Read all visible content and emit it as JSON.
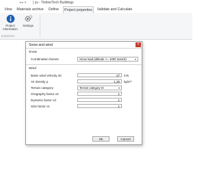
{
  "app": {
    "title": "| ys - TimberTech Buildings",
    "qat_glyphs": "◂ ▸ ▾"
  },
  "tabs": [
    {
      "label": "View"
    },
    {
      "label": "Materials archive"
    },
    {
      "label": "Define"
    },
    {
      "label": "Project properties",
      "active": true
    },
    {
      "label": "Validate and Calculate"
    }
  ],
  "ribbon": {
    "project_info_label": "Project\nInformation",
    "settings_label": "Settings",
    "group_label": "properties"
  },
  "dialog": {
    "title": "Snow and wind",
    "close_label": "×",
    "snow_section": "Snow",
    "combination_label": "Combination factors",
    "combination_value": "Snow load (altitude <= 1000 mamsl)",
    "wind_section": "Wind",
    "rows": [
      {
        "label": "Basic wind velocity vb",
        "value": "27",
        "unit": "m/s"
      },
      {
        "label": "Air density ρ",
        "value": "1.25",
        "unit": "kg/m³"
      },
      {
        "label": "Terrain category",
        "value": "Terrain category III",
        "type": "select"
      },
      {
        "label": "Orography factor c0",
        "value": "1"
      },
      {
        "label": "Dynamic factor cd",
        "value": "1"
      },
      {
        "label": "Size factor cs",
        "value": "1"
      }
    ],
    "ok_label": "Ok",
    "cancel_label": "Cancel"
  },
  "colors": {
    "accent_blue": "#1e5fb4",
    "close_red": "#c7392f"
  }
}
